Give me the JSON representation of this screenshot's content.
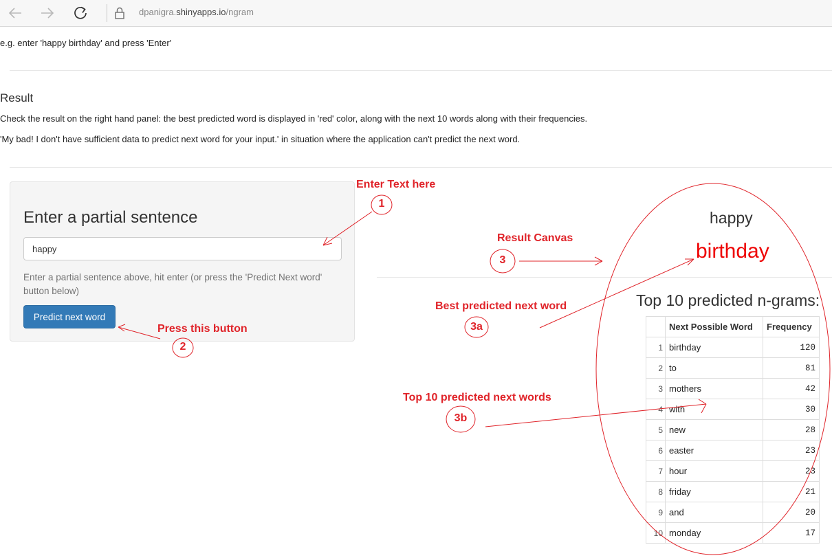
{
  "browser": {
    "url_prefix": "dpanigra.",
    "url_domain": "shinyapps.io",
    "url_path": "/ngram",
    "icons": [
      "back-arrow-icon",
      "forward-arrow-icon",
      "reload-icon",
      "lock-icon"
    ]
  },
  "intro": {
    "example": "e.g. enter 'happy birthday' and press 'Enter'"
  },
  "result_section": {
    "heading": "Result",
    "line1": "Check the result on the right hand panel: the best predicted word is displayed in 'red' color, along with the next 10 words along with their frequencies.",
    "line2": "'My bad! I don't have sufficient data to predict next word for your input.' in situation where the application can't predict the next word."
  },
  "sidebar": {
    "title": "Enter a partial sentence",
    "input_value": "happy",
    "help_text": "Enter a partial sentence above, hit enter (or press the 'Predict Next word' button below)",
    "button_label": "Predict next word"
  },
  "output": {
    "input_echo": "happy",
    "best_word": "birthday",
    "table_heading": "Top 10 predicted n-grams:",
    "columns": [
      "",
      "Next Possible Word",
      "Frequency"
    ],
    "rows": [
      {
        "idx": "1",
        "word": "birthday",
        "freq": "120"
      },
      {
        "idx": "2",
        "word": "to",
        "freq": "81"
      },
      {
        "idx": "3",
        "word": "mothers",
        "freq": "42"
      },
      {
        "idx": "4",
        "word": "with",
        "freq": "30"
      },
      {
        "idx": "5",
        "word": "new",
        "freq": "28"
      },
      {
        "idx": "6",
        "word": "easter",
        "freq": "23"
      },
      {
        "idx": "7",
        "word": "hour",
        "freq": "23"
      },
      {
        "idx": "8",
        "word": "friday",
        "freq": "21"
      },
      {
        "idx": "9",
        "word": "and",
        "freq": "20"
      },
      {
        "idx": "10",
        "word": "monday",
        "freq": "17"
      }
    ]
  },
  "annotations": {
    "enter_text": "Enter Text here",
    "n1": "1",
    "press_button": "Press this button",
    "n2": "2",
    "result_canvas": "Result Canvas",
    "n3": "3",
    "best_predicted": "Best predicted next word",
    "n3a": "3a",
    "top10": "Top 10 predicted next words",
    "n3b": "3b",
    "color": "#e0242a"
  },
  "colors": {
    "button": "#337ab7",
    "best_word": "#ee0000"
  }
}
